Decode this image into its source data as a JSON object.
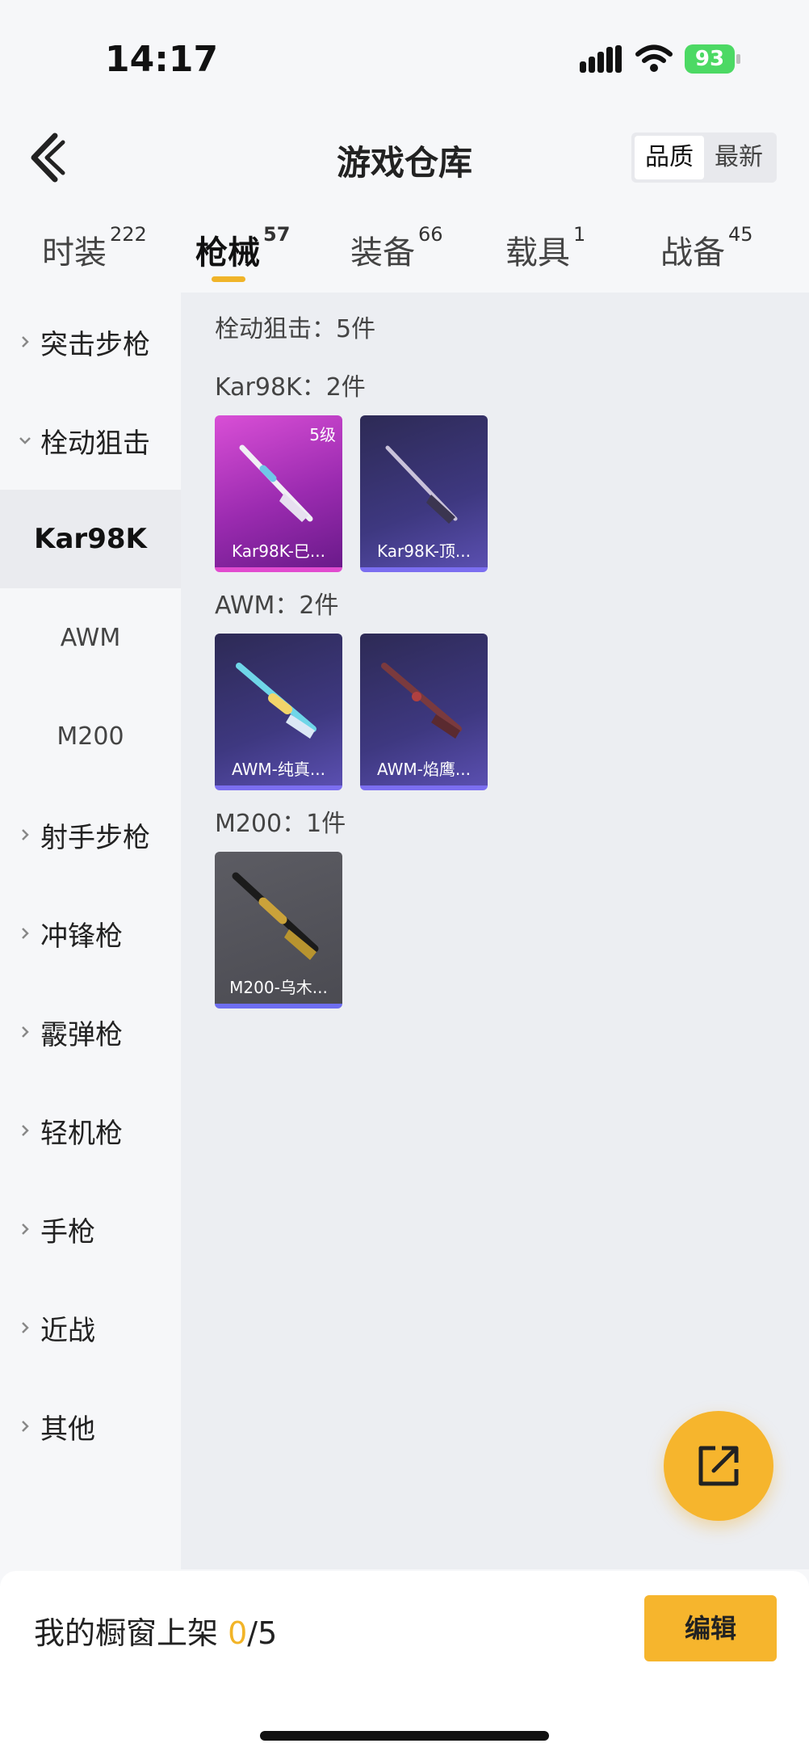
{
  "status_bar": {
    "time": "14:17",
    "battery": "93"
  },
  "header": {
    "title": "游戏仓库",
    "sort_options": [
      "品质",
      "最新"
    ],
    "sort_active": "品质"
  },
  "category_tabs": [
    {
      "label": "时装",
      "count": "222"
    },
    {
      "label": "枪械",
      "count": "57",
      "active": true
    },
    {
      "label": "装备",
      "count": "66"
    },
    {
      "label": "载具",
      "count": "1"
    },
    {
      "label": "战备",
      "count": "45"
    }
  ],
  "sidebar": {
    "items": [
      {
        "label": "突击步枪",
        "expanded": false
      },
      {
        "label": "栓动狙击",
        "expanded": true
      },
      {
        "label": "Kar98K",
        "sub": true,
        "selected": true
      },
      {
        "label": "AWM",
        "sub": true
      },
      {
        "label": "M200",
        "sub": true
      },
      {
        "label": "射手步枪"
      },
      {
        "label": "冲锋枪"
      },
      {
        "label": "霰弹枪"
      },
      {
        "label": "轻机枪"
      },
      {
        "label": "手枪"
      },
      {
        "label": "近战"
      },
      {
        "label": "其他"
      }
    ]
  },
  "content": {
    "summary": "栓动狙击：5件",
    "groups": [
      {
        "header": "Kar98K：2件",
        "items": [
          {
            "name": "Kar98K-巳...",
            "level": "5级",
            "rarity": "pink"
          },
          {
            "name": "Kar98K-顶...",
            "rarity": "purple"
          }
        ]
      },
      {
        "header": "AWM：2件",
        "items": [
          {
            "name": "AWM-纯真...",
            "rarity": "purple"
          },
          {
            "name": "AWM-焰鹰...",
            "rarity": "purple"
          }
        ]
      },
      {
        "header": "M200：1件",
        "items": [
          {
            "name": "M200-乌木...",
            "rarity": "gray"
          }
        ]
      }
    ]
  },
  "bottom_bar": {
    "showcase_prefix": "我的橱窗上架 ",
    "showcase_current": "0",
    "showcase_total": "/5",
    "edit_label": "编辑"
  },
  "colors": {
    "accent": "#f6b52d",
    "pink_rarity": "#e14bd0",
    "purple_rarity": "#7b6ef0"
  },
  "icons": {
    "fab": "share-external-icon",
    "back": "back-chevron-icon"
  }
}
